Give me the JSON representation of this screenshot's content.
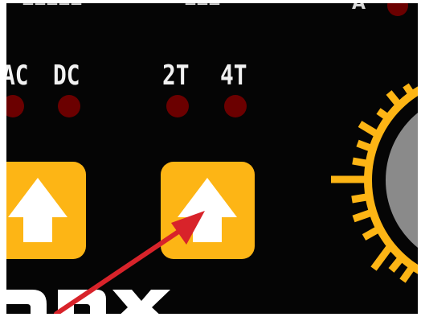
{
  "panel": {
    "mode_labels": {
      "ac": "AC",
      "dc": "DC",
      "two_t": "2T",
      "four_t": "4T"
    },
    "top_cut_text": [
      "—————",
      "———",
      "A"
    ],
    "icons": {
      "mode_button": "up-arrow-icon",
      "trigger_button": "up-arrow-icon",
      "pointer": "red-pointer-arrow",
      "dial": "control-knob"
    },
    "colors": {
      "panel_background": "#050505",
      "button": "#fdb515",
      "led_off": "#6b0000",
      "dial_scale": "#fdb515",
      "knob": "#8a8a8a",
      "pointer": "#d8232a",
      "label_text": "#f2f2f2"
    }
  }
}
